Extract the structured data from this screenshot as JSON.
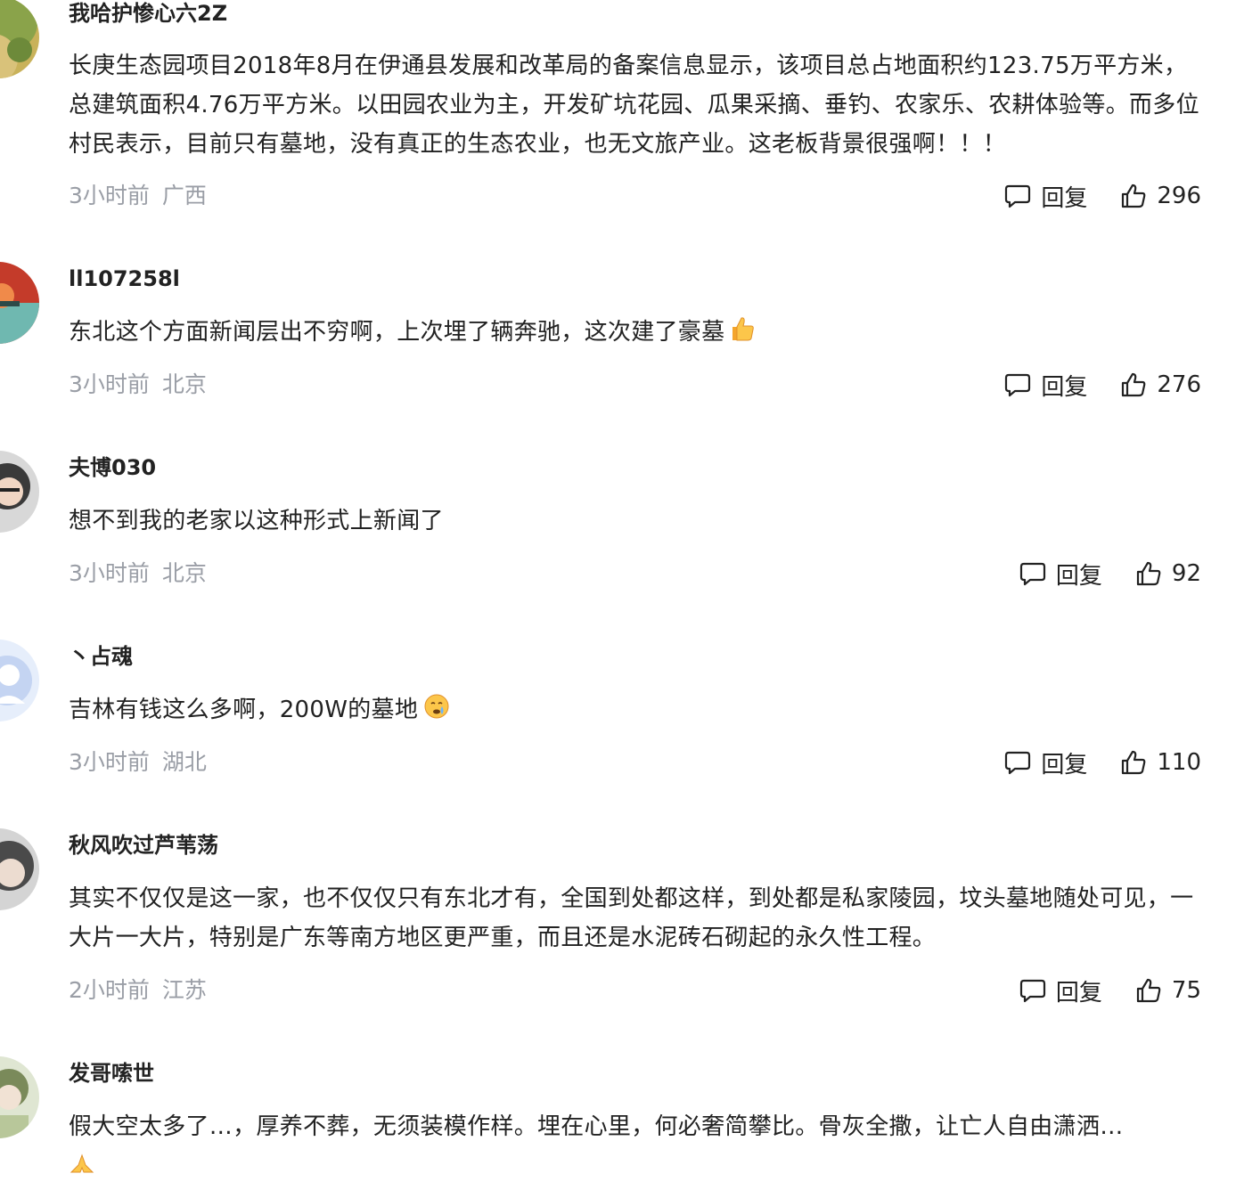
{
  "reply_label": "回复",
  "comments": [
    {
      "username": "我哈护惨心六2Z",
      "content": "长庚生态园项目2018年8月在伊通县发展和改革局的备案信息显示，该项目总占地面积约123.75万平方米，总建筑面积4.76万平方米。以田园农业为主，开发矿坑花园、瓜果采摘、垂钓、农家乐、农耕体验等。而多位村民表示，目前只有墓地，没有真正的生态农业，也无文旅产业。这老板背景很强啊！！！",
      "time": "3小时前",
      "location": "广西",
      "likes": "296"
    },
    {
      "username": "ll107258l",
      "content": "东北这个方面新闻层出不穷啊，上次埋了辆奔驰，这次建了豪墓",
      "emoji": "thumbs-up-emoji",
      "time": "3小时前",
      "location": "北京",
      "likes": "276"
    },
    {
      "username": "夫博030",
      "content": "想不到我的老家以这种形式上新闻了",
      "time": "3小时前",
      "location": "北京",
      "likes": "92"
    },
    {
      "username": "丶占魂",
      "content": "吉林有钱这么多啊，200W的墓地",
      "emoji": "crying-emoji",
      "time": "3小时前",
      "location": "湖北",
      "likes": "110"
    },
    {
      "username": "秋风吹过芦苇荡",
      "content": "其实不仅仅是这一家，也不仅仅只有东北才有，全国到处都这样，到处都是私家陵园，坟头墓地随处可见，一大片一大片，特别是广东等南方地区更严重，而且还是水泥砖石砌起的永久性工程。",
      "time": "2小时前",
      "location": "江苏",
      "likes": "75"
    },
    {
      "username": "发哥嗦世",
      "content": "假大空太多了…，厚养不葬，无须装模作样。埋在心里，何必奢简攀比。骨灰全撒，让亡人自由潇洒…",
      "emoji": "praying-hands-emoji"
    }
  ]
}
